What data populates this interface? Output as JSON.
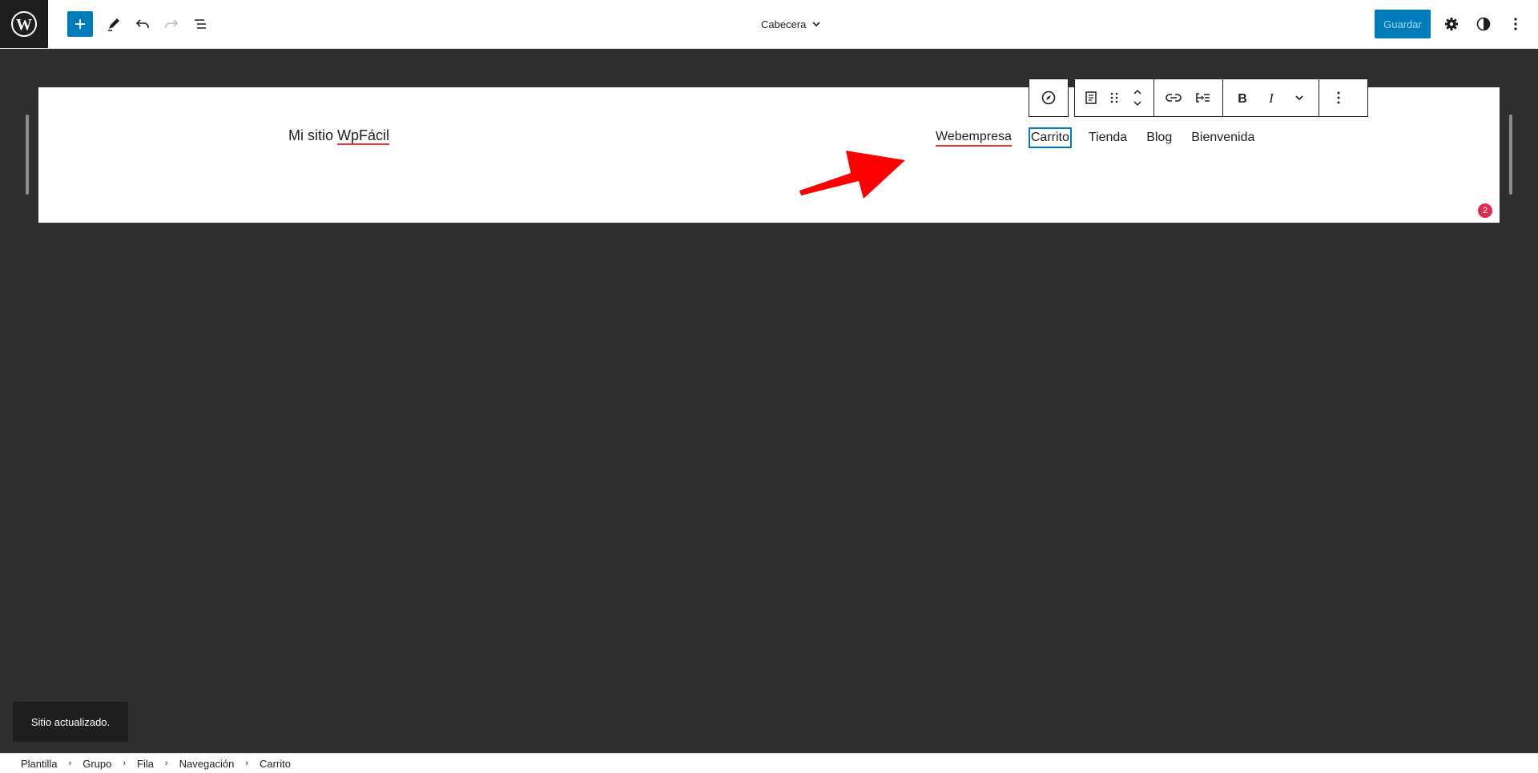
{
  "header": {
    "document_title": "Cabecera",
    "save_label": "Guardar"
  },
  "canvas": {
    "site_title_prefix": "Mi sitio ",
    "site_title_suffix": "WpFácil",
    "nav_items": [
      "Webempresa",
      "Carrito",
      "Tienda",
      "Blog",
      "Bienvenida"
    ],
    "notification_count": "2"
  },
  "snackbar": {
    "message": "Sitio actualizado."
  },
  "breadcrumbs": [
    "Plantilla",
    "Grupo",
    "Fila",
    "Navegación",
    "Carrito"
  ],
  "colors": {
    "accent": "#007cba",
    "annotation_arrow": "#ff0000",
    "badge": "#e02d4f"
  }
}
